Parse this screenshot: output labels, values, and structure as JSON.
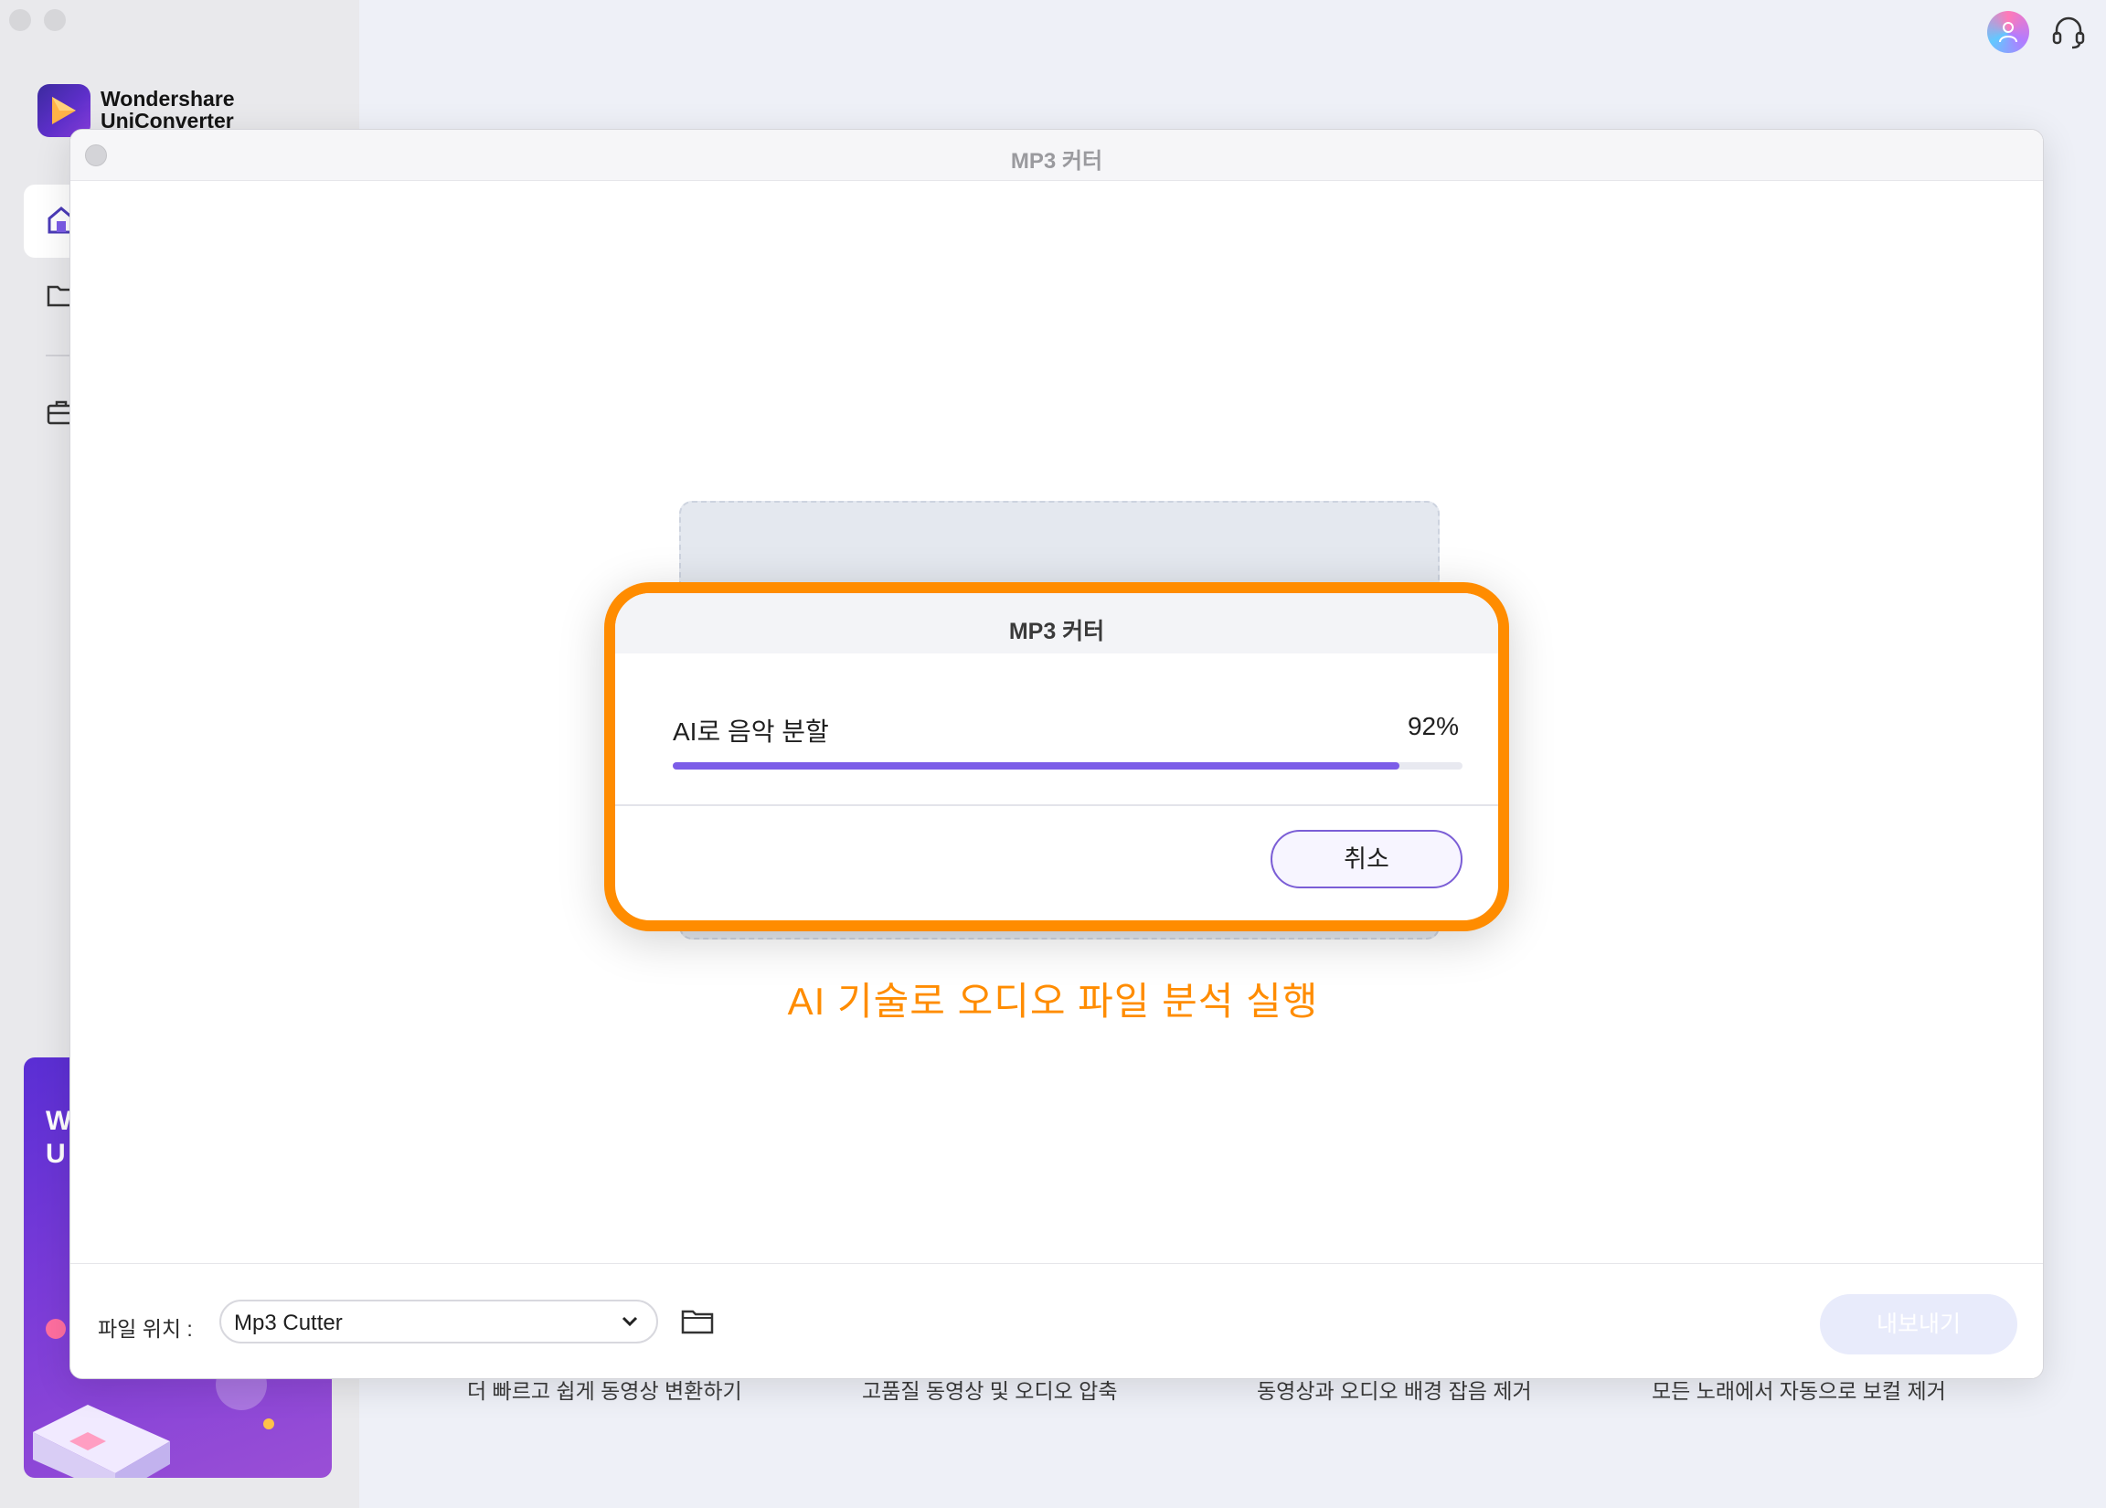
{
  "app": {
    "brand_line1": "Wondershare",
    "brand_line2": "UniConverter",
    "promo_text_line1": "W",
    "promo_text_line2": "U"
  },
  "background_captions": [
    "더 빠르고 쉽게 동영상 변환하기",
    "고품질 동영상 및 오디오 압축",
    "동영상과 오디오 배경 잡음 제거",
    "모든 노래에서 자동으로 보컬 제거"
  ],
  "window": {
    "title": "MP3 커터"
  },
  "modal": {
    "title": "MP3 커터",
    "task_label": "AI로 음악 분할",
    "progress_percent_text": "92%",
    "progress_value": 0.92,
    "cancel_label": "취소"
  },
  "annotation": "AI 기술로 오디오 파일 분석 실행",
  "footer": {
    "location_label": "파일 위치 :",
    "location_value": "Mp3 Cutter",
    "export_label": "내보내기"
  },
  "colors": {
    "accent": "#7c5de8",
    "highlight": "#ff8c00",
    "brand": "#5d2fc9"
  },
  "icons": [
    "home-icon",
    "folder-icon",
    "toolbox-icon",
    "avatar-icon",
    "headset-icon",
    "chevron-down-icon",
    "folder-open-icon",
    "close-icon"
  ]
}
